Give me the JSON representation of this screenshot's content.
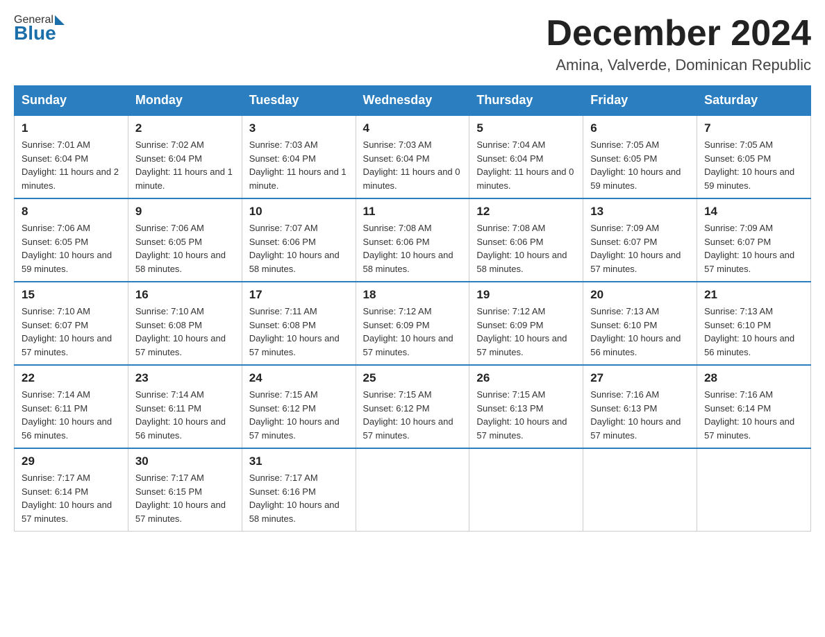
{
  "header": {
    "logo": {
      "general": "General",
      "blue": "Blue"
    },
    "title": "December 2024",
    "location": "Amina, Valverde, Dominican Republic"
  },
  "weekdays": [
    "Sunday",
    "Monday",
    "Tuesday",
    "Wednesday",
    "Thursday",
    "Friday",
    "Saturday"
  ],
  "weeks": [
    [
      {
        "day": "1",
        "sunrise": "7:01 AM",
        "sunset": "6:04 PM",
        "daylight": "11 hours and 2 minutes."
      },
      {
        "day": "2",
        "sunrise": "7:02 AM",
        "sunset": "6:04 PM",
        "daylight": "11 hours and 1 minute."
      },
      {
        "day": "3",
        "sunrise": "7:03 AM",
        "sunset": "6:04 PM",
        "daylight": "11 hours and 1 minute."
      },
      {
        "day": "4",
        "sunrise": "7:03 AM",
        "sunset": "6:04 PM",
        "daylight": "11 hours and 0 minutes."
      },
      {
        "day": "5",
        "sunrise": "7:04 AM",
        "sunset": "6:04 PM",
        "daylight": "11 hours and 0 minutes."
      },
      {
        "day": "6",
        "sunrise": "7:05 AM",
        "sunset": "6:05 PM",
        "daylight": "10 hours and 59 minutes."
      },
      {
        "day": "7",
        "sunrise": "7:05 AM",
        "sunset": "6:05 PM",
        "daylight": "10 hours and 59 minutes."
      }
    ],
    [
      {
        "day": "8",
        "sunrise": "7:06 AM",
        "sunset": "6:05 PM",
        "daylight": "10 hours and 59 minutes."
      },
      {
        "day": "9",
        "sunrise": "7:06 AM",
        "sunset": "6:05 PM",
        "daylight": "10 hours and 58 minutes."
      },
      {
        "day": "10",
        "sunrise": "7:07 AM",
        "sunset": "6:06 PM",
        "daylight": "10 hours and 58 minutes."
      },
      {
        "day": "11",
        "sunrise": "7:08 AM",
        "sunset": "6:06 PM",
        "daylight": "10 hours and 58 minutes."
      },
      {
        "day": "12",
        "sunrise": "7:08 AM",
        "sunset": "6:06 PM",
        "daylight": "10 hours and 58 minutes."
      },
      {
        "day": "13",
        "sunrise": "7:09 AM",
        "sunset": "6:07 PM",
        "daylight": "10 hours and 57 minutes."
      },
      {
        "day": "14",
        "sunrise": "7:09 AM",
        "sunset": "6:07 PM",
        "daylight": "10 hours and 57 minutes."
      }
    ],
    [
      {
        "day": "15",
        "sunrise": "7:10 AM",
        "sunset": "6:07 PM",
        "daylight": "10 hours and 57 minutes."
      },
      {
        "day": "16",
        "sunrise": "7:10 AM",
        "sunset": "6:08 PM",
        "daylight": "10 hours and 57 minutes."
      },
      {
        "day": "17",
        "sunrise": "7:11 AM",
        "sunset": "6:08 PM",
        "daylight": "10 hours and 57 minutes."
      },
      {
        "day": "18",
        "sunrise": "7:12 AM",
        "sunset": "6:09 PM",
        "daylight": "10 hours and 57 minutes."
      },
      {
        "day": "19",
        "sunrise": "7:12 AM",
        "sunset": "6:09 PM",
        "daylight": "10 hours and 57 minutes."
      },
      {
        "day": "20",
        "sunrise": "7:13 AM",
        "sunset": "6:10 PM",
        "daylight": "10 hours and 56 minutes."
      },
      {
        "day": "21",
        "sunrise": "7:13 AM",
        "sunset": "6:10 PM",
        "daylight": "10 hours and 56 minutes."
      }
    ],
    [
      {
        "day": "22",
        "sunrise": "7:14 AM",
        "sunset": "6:11 PM",
        "daylight": "10 hours and 56 minutes."
      },
      {
        "day": "23",
        "sunrise": "7:14 AM",
        "sunset": "6:11 PM",
        "daylight": "10 hours and 56 minutes."
      },
      {
        "day": "24",
        "sunrise": "7:15 AM",
        "sunset": "6:12 PM",
        "daylight": "10 hours and 57 minutes."
      },
      {
        "day": "25",
        "sunrise": "7:15 AM",
        "sunset": "6:12 PM",
        "daylight": "10 hours and 57 minutes."
      },
      {
        "day": "26",
        "sunrise": "7:15 AM",
        "sunset": "6:13 PM",
        "daylight": "10 hours and 57 minutes."
      },
      {
        "day": "27",
        "sunrise": "7:16 AM",
        "sunset": "6:13 PM",
        "daylight": "10 hours and 57 minutes."
      },
      {
        "day": "28",
        "sunrise": "7:16 AM",
        "sunset": "6:14 PM",
        "daylight": "10 hours and 57 minutes."
      }
    ],
    [
      {
        "day": "29",
        "sunrise": "7:17 AM",
        "sunset": "6:14 PM",
        "daylight": "10 hours and 57 minutes."
      },
      {
        "day": "30",
        "sunrise": "7:17 AM",
        "sunset": "6:15 PM",
        "daylight": "10 hours and 57 minutes."
      },
      {
        "day": "31",
        "sunrise": "7:17 AM",
        "sunset": "6:16 PM",
        "daylight": "10 hours and 58 minutes."
      },
      null,
      null,
      null,
      null
    ]
  ]
}
